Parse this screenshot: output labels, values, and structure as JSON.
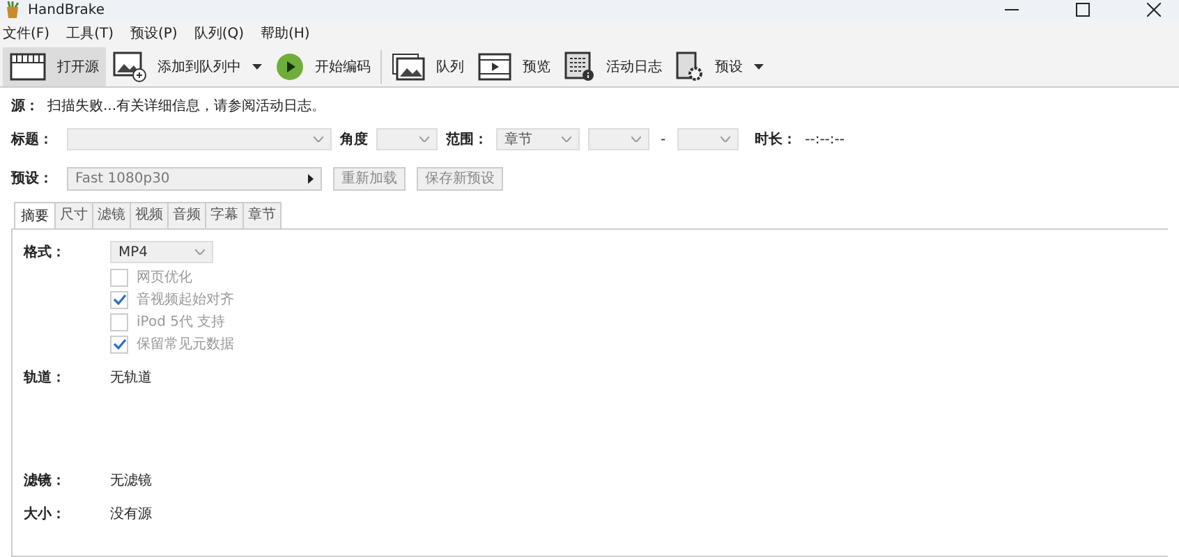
{
  "window": {
    "title": "HandBrake"
  },
  "menu": [
    {
      "label": "文件(F)"
    },
    {
      "label": "工具(T)"
    },
    {
      "label": "预设(P)"
    },
    {
      "label": "队列(Q)"
    },
    {
      "label": "帮助(H)"
    }
  ],
  "toolbar": [
    {
      "label": "打开源",
      "selected": true,
      "dropdown": false
    },
    {
      "label": "添加到队列中",
      "selected": false,
      "dropdown": true
    },
    {
      "label": "开始编码",
      "selected": false,
      "dropdown": false
    },
    {
      "label": "队列",
      "selected": false,
      "dropdown": false
    },
    {
      "label": "预览",
      "selected": false,
      "dropdown": false
    },
    {
      "label": "活动日志",
      "selected": false,
      "dropdown": false
    },
    {
      "label": "预设",
      "selected": false,
      "dropdown": true
    }
  ],
  "source": {
    "label": "源：",
    "message": "扫描失败...有关详细信息，请参阅活动日志。"
  },
  "title_row": {
    "title_label": "标题：",
    "angle_label": "角度",
    "range_label": "范围：",
    "range_mode": "章节",
    "range_separator": "-",
    "duration_label": "时长：",
    "duration": "--:--:--"
  },
  "preset_row": {
    "label": "预设：",
    "value": "Fast 1080p30",
    "buttons": [
      "重新加载",
      "保存新预设"
    ]
  },
  "tabs": [
    {
      "label": "摘要",
      "selected": true
    },
    {
      "label": "尺寸",
      "selected": false
    },
    {
      "label": "滤镜",
      "selected": false
    },
    {
      "label": "视频",
      "selected": false
    },
    {
      "label": "音频",
      "selected": false
    },
    {
      "label": "字幕",
      "selected": false
    },
    {
      "label": "章节",
      "selected": false
    }
  ],
  "summary": {
    "format_label": "格式：",
    "format": "MP4",
    "options": [
      {
        "label": "网页优化",
        "checked": false,
        "disabled": true
      },
      {
        "label": "音视频起始对齐",
        "checked": true,
        "disabled": true
      },
      {
        "label": "iPod 5代 支持",
        "checked": false,
        "disabled": true
      },
      {
        "label": "保留常见元数据",
        "checked": true,
        "disabled": true
      }
    ],
    "tracks_label": "轨道：",
    "tracks": "无轨道",
    "filters_label": "滤镜：",
    "filters": "无滤镜",
    "size_label": "大小：",
    "size": "没有源"
  }
}
